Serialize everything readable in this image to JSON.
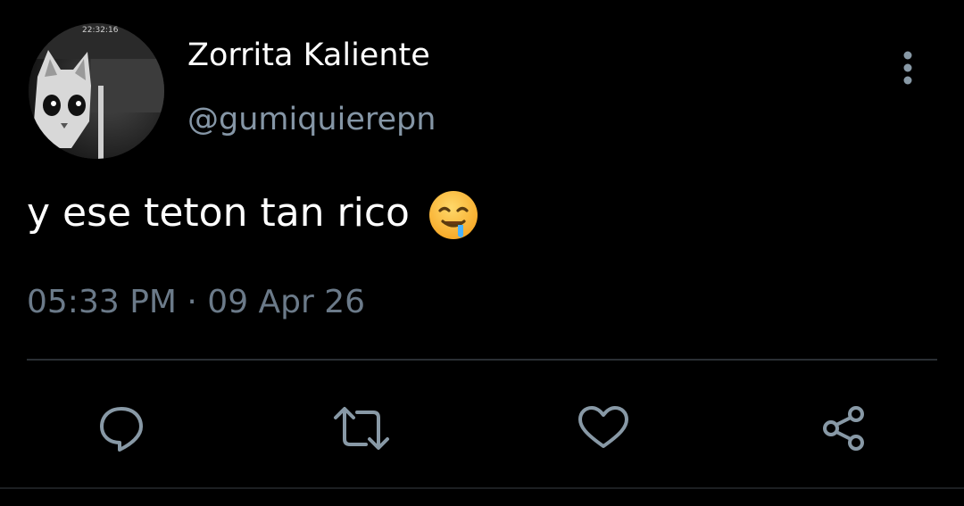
{
  "tweet": {
    "display_name": "Zorrita Kaliente",
    "handle": "@gumiquierepn",
    "text": "y ese teton tan rico",
    "emoji": "drooling-face",
    "timestamp": "05:33 PM · 09 Apr 26",
    "avatar_overlay_text": "22:32:16"
  },
  "actions": [
    {
      "name": "reply",
      "icon": "comment-icon"
    },
    {
      "name": "retweet",
      "icon": "retweet-icon"
    },
    {
      "name": "like",
      "icon": "heart-icon"
    },
    {
      "name": "share",
      "icon": "share-icon"
    }
  ],
  "colors": {
    "background": "#000000",
    "primary_text": "#ffffff",
    "secondary_text": "#8596a6",
    "icon": "#8899a6",
    "divider": "#2a2f34"
  }
}
